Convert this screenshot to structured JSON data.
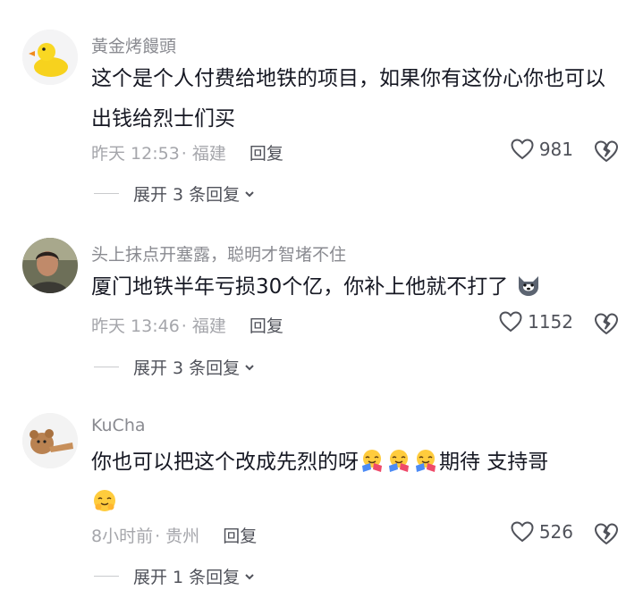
{
  "comments": [
    {
      "username": "黃金烤饅頭",
      "text": "这个是个人付费给地铁的项目，如果你有这份心你也可以出钱给烈士们买",
      "time": "昨天 12:53",
      "location": "· 福建",
      "reply_label": "回复",
      "likes": "981",
      "expand_label": "展开 3 条回复",
      "avatar_icon": "duck-avatar"
    },
    {
      "username": "头上抹点开塞露，聪明才智堵不住",
      "text": "厦门地铁半年亏损30个亿，你补上他就不打了",
      "time": "昨天 13:46",
      "location": "· 福建",
      "reply_label": "回复",
      "likes": "1152",
      "expand_label": "展开 3 条回复",
      "avatar_icon": "man-photo-avatar",
      "trailing_emoji": "husky-dog-emoji"
    },
    {
      "username": "KuCha",
      "text": "你也可以把这个改成先烈的呀",
      "text_suffix": "期待 支持哥",
      "time": "8小时前",
      "location": "· 贵州",
      "reply_label": "回复",
      "likes": "526",
      "expand_label": "展开 1 条回复",
      "avatar_icon": "bear-toy-avatar",
      "emojis": [
        "hugging-face-emoji",
        "hugging-face-emoji",
        "hugging-face-emoji",
        "hugging-face-emoji"
      ]
    }
  ],
  "colors": {
    "text": "#161823",
    "muted": "#a5a6ab",
    "username": "#8a8b91",
    "action": "#50525a"
  }
}
